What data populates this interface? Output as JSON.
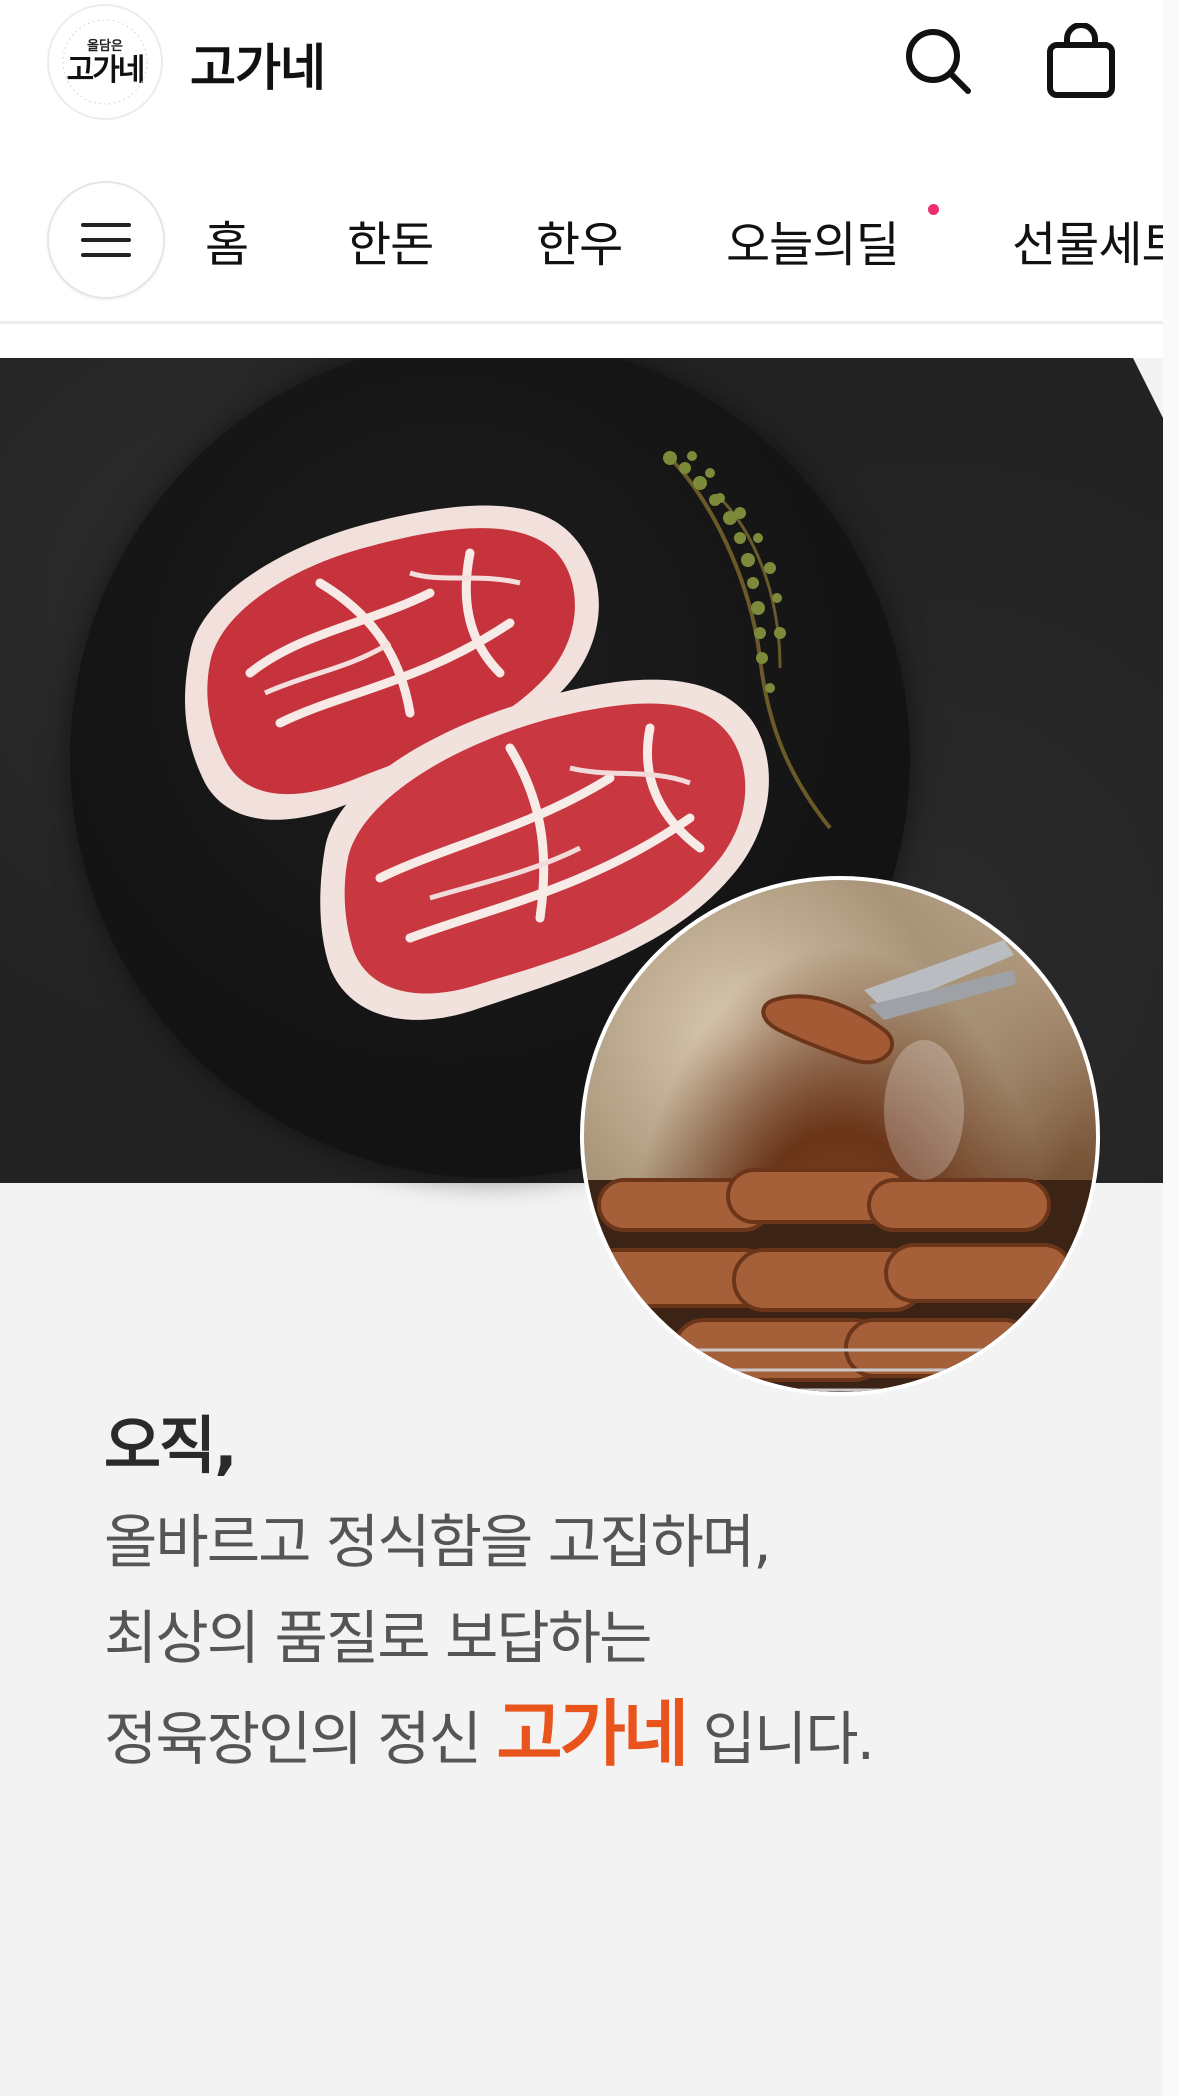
{
  "header": {
    "logo_small_text": "올담은",
    "logo_text": "고가네",
    "brand_name": "고가네",
    "icons": [
      "search-icon",
      "shopping-bag-icon"
    ]
  },
  "nav": {
    "menu_icon": "hamburger-menu-icon",
    "items": [
      {
        "label": "홈"
      },
      {
        "label": "한돈"
      },
      {
        "label": "한우"
      },
      {
        "label": "오늘의딜",
        "has_dot": true
      },
      {
        "label": "선물세트"
      }
    ],
    "dot_color": "#ee2e72"
  },
  "banner": {
    "line1": "오직,",
    "line2": "올바르고 정식함을 고집하며,",
    "line3": "최상의 품질로 보답하는",
    "line4_prefix": "정육장인의 정신 ",
    "line4_accent": "고가네",
    "line4_suffix": " 입니다.",
    "accent_color": "#e8541c"
  }
}
